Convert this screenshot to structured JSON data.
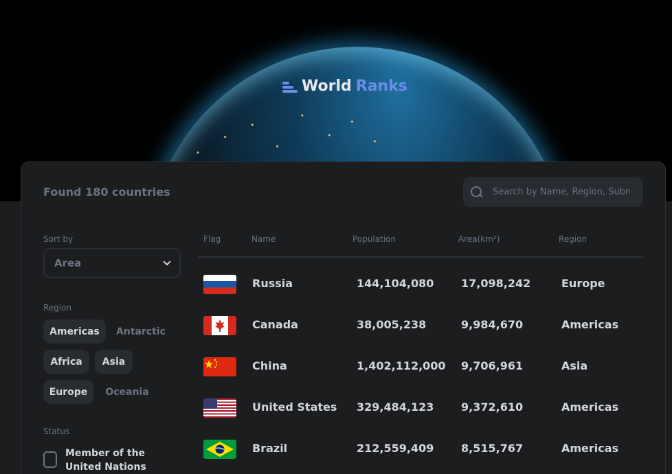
{
  "app": {
    "title_part1": "World",
    "title_part2": "Ranks"
  },
  "summary": {
    "found": "Found 180 countries"
  },
  "search": {
    "placeholder": "Search by Name, Region, Subregion"
  },
  "sort": {
    "label": "Sort by",
    "value": "Area"
  },
  "region": {
    "label": "Region",
    "chips": [
      {
        "label": "Americas",
        "active": true
      },
      {
        "label": "Antarctic",
        "active": false
      },
      {
        "label": "Africa",
        "active": true
      },
      {
        "label": "Asia",
        "active": true
      },
      {
        "label": "Europe",
        "active": true
      },
      {
        "label": "Oceania",
        "active": false
      }
    ]
  },
  "status": {
    "label": "Status",
    "option": "Member of the United Nations",
    "checked": false
  },
  "table": {
    "headers": [
      "Flag",
      "Name",
      "Population",
      "Area(km²)",
      "Region"
    ],
    "rows": [
      {
        "name": "Russia",
        "population": "144,104,080",
        "area": "17,098,242",
        "region": "Europe",
        "flag": "russia-flag-icon"
      },
      {
        "name": "Canada",
        "population": "38,005,238",
        "area": "9,984,670",
        "region": "Americas",
        "flag": "canada-flag-icon"
      },
      {
        "name": "China",
        "population": "1,402,112,000",
        "area": "9,706,961",
        "region": "Asia",
        "flag": "china-flag-icon"
      },
      {
        "name": "United States",
        "population": "329,484,123",
        "area": "9,372,610",
        "region": "Americas",
        "flag": "us-flag-icon"
      },
      {
        "name": "Brazil",
        "population": "212,559,409",
        "area": "8,515,767",
        "region": "Americas",
        "flag": "brazil-flag-icon"
      }
    ]
  },
  "colors": {
    "accent": "#6a8eea",
    "panel": "#1c1d1f",
    "muted": "#6c727f",
    "text": "#d2d5da"
  }
}
